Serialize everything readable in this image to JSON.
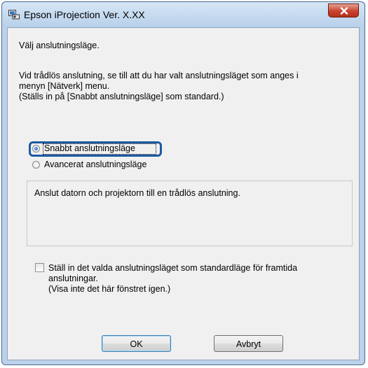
{
  "window": {
    "title": "Epson iProjection Ver. X.XX"
  },
  "dialog": {
    "intro": "Välj anslutningsläge.",
    "info_line1": "Vid trådlös anslutning, se till att du har valt anslutningsläget som anges i",
    "info_line2": "menyn [Nätverk] menu.",
    "info_line3": "(Ställs in på [Snabbt anslutningsläge] som standard.)",
    "options": [
      {
        "label": "Snabbt anslutningsläge",
        "selected": true
      },
      {
        "label": "Avancerat anslutningsläge",
        "selected": false
      }
    ],
    "description": "Anslut datorn och projektorn till en trådlös anslutning.",
    "default_checkbox": {
      "checked": false,
      "line1": "Ställ in det valda anslutningsläget som standardläge för framtida",
      "line2": "anslutningar.",
      "line3": "(Visa inte det här fönstret igen.)"
    },
    "buttons": {
      "ok": "OK",
      "cancel": "Avbryt"
    }
  },
  "colors": {
    "focus_ring": "#1c5aa3",
    "close_button": "#c7432f"
  }
}
